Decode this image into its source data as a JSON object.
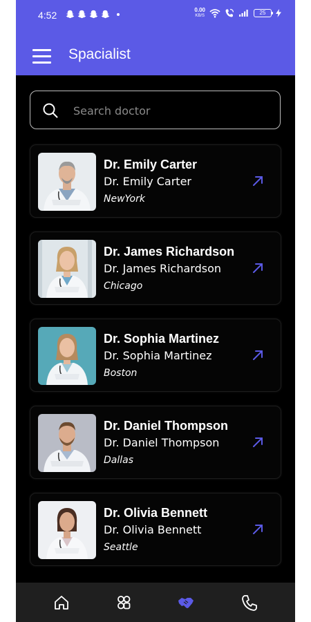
{
  "status": {
    "time": "4:52",
    "notification_icons": [
      "snapchat-icon",
      "snapchat-icon",
      "snapchat-icon",
      "snapchat-icon"
    ],
    "speed_value": "0.00",
    "speed_unit": "KB/S",
    "battery": "25"
  },
  "appbar": {
    "title": "Spacialist",
    "menu_icon": "hamburger-menu-icon"
  },
  "search": {
    "placeholder": "Search doctor",
    "value": ""
  },
  "doctors": [
    {
      "name": "Dr. Emily Carter",
      "subtitle": "Dr. Emily Carter",
      "city": "NewYork",
      "avatar": "doctor-male-gray-hair",
      "avatar_bg": "#e8ecef"
    },
    {
      "name": "Dr. James Richardson",
      "subtitle": "Dr. James Richardson",
      "city": "Chicago",
      "avatar": "doctor-female-blonde",
      "avatar_bg": "#dfe6ea"
    },
    {
      "name": "Dr. Sophia Martinez",
      "subtitle": "Dr. Sophia Martinez",
      "city": "Boston",
      "avatar": "doctor-female-teal-bg",
      "avatar_bg": "#56a9b8"
    },
    {
      "name": "Dr. Daniel Thompson",
      "subtitle": "Dr. Daniel Thompson",
      "city": "Dallas",
      "avatar": "doctor-male-beard",
      "avatar_bg": "#b9bcc6"
    },
    {
      "name": "Dr. Olivia Bennett",
      "subtitle": "Dr. Olivia Bennett",
      "city": "Seattle",
      "avatar": "doctor-female-brunette",
      "avatar_bg": "#eef0f3"
    }
  ],
  "bottom_nav": [
    {
      "icon": "home-icon",
      "active": false
    },
    {
      "icon": "categories-icon",
      "active": false
    },
    {
      "icon": "handshake-icon",
      "active": true
    },
    {
      "icon": "phone-icon",
      "active": false
    }
  ],
  "colors": {
    "accent": "#5b5ae6",
    "background": "#000000",
    "card": "#050505",
    "nav_bar": "#1f1f1f",
    "arrow": "#5b5ae6"
  }
}
